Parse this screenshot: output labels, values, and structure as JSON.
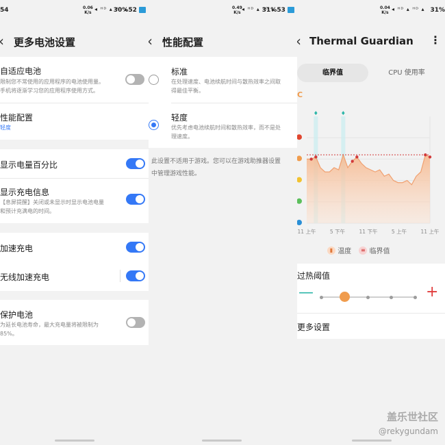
{
  "panel1": {
    "status": {
      "time": "54",
      "speed": "0.06",
      "speed_unit": "K/s",
      "icons": "◂ ᵸᴰ ▴ ᴴᴰ ▴",
      "battery": "30%52"
    },
    "title": "更多电池设置",
    "back_icon": "chevron-left-icon",
    "rows": {
      "adaptive": {
        "title": "自适应电池",
        "sub1": "限制您不常使用的应用程序的电池使用量。",
        "sub2": "手机将逐渐学习您的应用程序使用方式。",
        "on": false
      },
      "performance": {
        "title": "性能配置",
        "sub": "轻度"
      },
      "percent": {
        "title": "显示电量百分比",
        "on": true
      },
      "charge_info": {
        "title": "显示充电信息",
        "sub1": "【息屏提醒】关闭或未显示时显示电池电量",
        "sub2": "和预计充满电的时间。",
        "on": true
      },
      "fast": {
        "title": "加速充电",
        "on": true
      },
      "wireless_fast": {
        "title": "无线加速充电",
        "on": true
      },
      "protect": {
        "title": "保护电池",
        "sub1": "为延长电池寿命，最大充电量将被限制为",
        "sub2": "85%。",
        "on": false
      }
    }
  },
  "panel2": {
    "status": {
      "speed": "0.49",
      "speed_unit": "K/s",
      "icons": "◂ ᵸᴰ ▴ ᴴᴰ ▴",
      "battery": "31%53"
    },
    "title": "性能配置",
    "options": {
      "standard": {
        "title": "标准",
        "sub1": "在处理速度、电池续航时间与散热效率之间取",
        "sub2": "得最佳平衡。",
        "selected": false
      },
      "light": {
        "title": "轻度",
        "sub1": "优先考虑电池续航时间和散热效率，而不是处",
        "sub2": "理速度。",
        "selected": true
      }
    },
    "note1": "此设置不适用于游戏。您可以在游戏助推器设置",
    "note2": "中管理游戏性能。"
  },
  "panel3": {
    "status": {
      "speed": "0.04",
      "speed_unit": "K/s",
      "icons": "◂ ᵸᴰ ▴ ᴴᴰ ▴",
      "battery": "31%"
    },
    "title": "Thermal Guardian",
    "menu_icon": "more-vertical-icon",
    "tabs": {
      "active": "临界值",
      "inactive": "CPU 使用率"
    },
    "unit": "C",
    "legend": {
      "temp": "温度",
      "threshold": "临界值"
    },
    "overheat_title": "过热阈值",
    "minus_icon": "minus-icon",
    "plus_icon": "plus-icon",
    "slider": {
      "steps": 5,
      "value_index": 1
    },
    "more": "更多设置",
    "colors": {
      "accent": "#f09c4d",
      "threshold_line": "#d13a3a",
      "minus": "#2bb6a8",
      "plus": "#e03b3b"
    }
  },
  "chart_data": {
    "type": "area",
    "title": "",
    "xlabel": "",
    "ylabel": "",
    "x_ticks": [
      "11 上午",
      "5 下午",
      "11 下午",
      "5 上午",
      "11 上午"
    ],
    "y_levels": 5,
    "ylim": [
      0,
      5
    ],
    "threshold": 3.2,
    "grid": true,
    "series": [
      {
        "values": [
          3.0,
          3.0,
          3.1,
          2.6,
          2.4,
          2.4,
          2.6,
          2.5,
          3.2,
          2.6,
          2.9,
          3.1,
          2.8,
          2.6,
          2.5,
          2.4,
          2.5,
          2.2,
          2.3,
          2.0,
          1.9,
          1.9,
          2.0,
          1.8,
          2.2,
          2.4,
          3.2,
          3.1
        ],
        "markers": [
          1,
          2,
          10,
          11,
          26,
          27
        ]
      }
    ],
    "highlight_bands": [
      2,
      8
    ],
    "band_marker": "♦"
  }
}
